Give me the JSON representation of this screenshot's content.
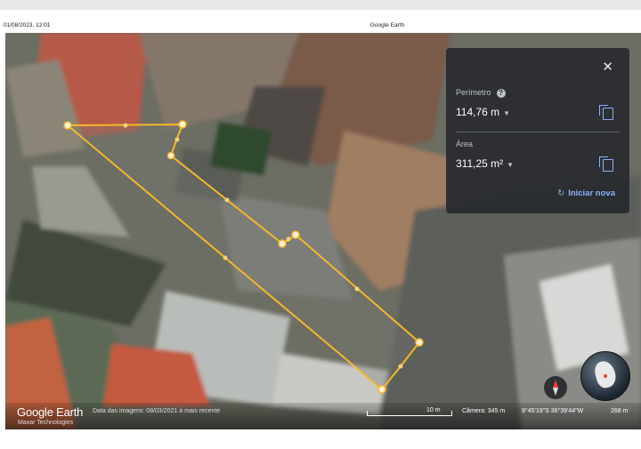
{
  "header": {
    "date_time": "01/08/2023, 12:01",
    "title": "Google Earth"
  },
  "measure_panel": {
    "perimeter_label": "Perímetro",
    "perimeter_value": "114,76 m",
    "area_label": "Área",
    "area_value": "311,25 m²",
    "restart_label": "Iniciar nova"
  },
  "footer": {
    "logo": "Google Earth",
    "attribution": "Maxar Technologies",
    "image_date": "Data das imagens: 08/03/2021 à mais recente",
    "scale_label": "10 m",
    "camera": "Câmera: 345 m",
    "coordinates": "9°45'19\"S 36°39'44\"W",
    "elevation": "268 m"
  },
  "colors": {
    "measure_line": "#f6b82a",
    "panel_bg": "#2a2c2f",
    "accent": "#8ab4f8"
  }
}
